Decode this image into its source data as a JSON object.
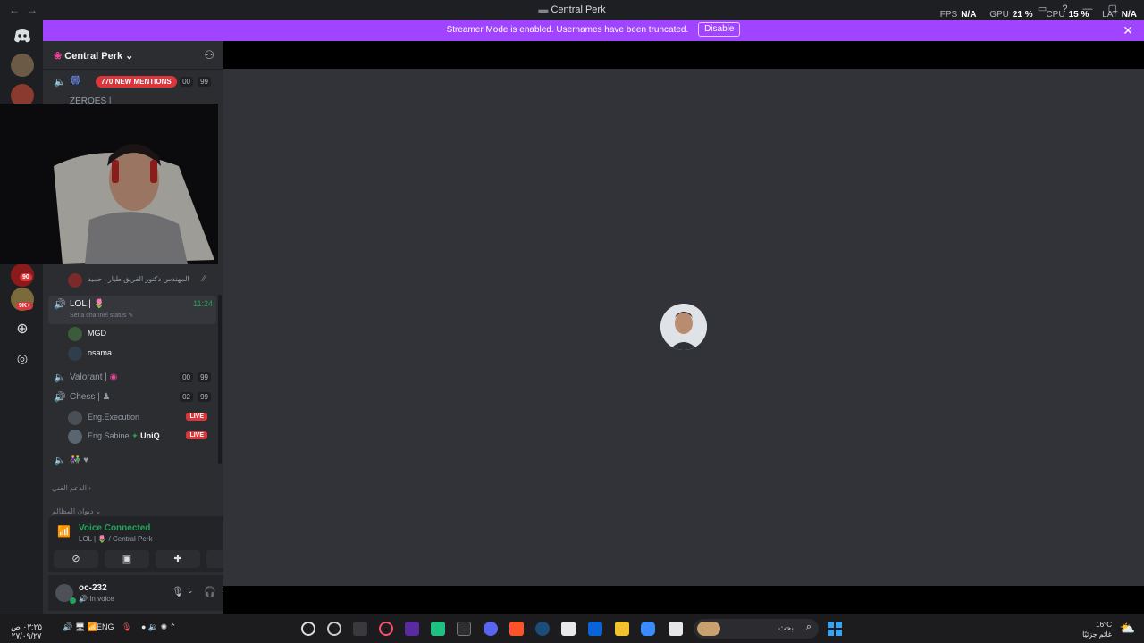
{
  "titlebar": {
    "back": "←",
    "forward": "→",
    "title": "Central Perk",
    "stats": {
      "fps_label": "FPS",
      "fps_value": "N/A",
      "gpu_label": "GPU",
      "gpu_value": "21 %",
      "cpu_label": "CPU",
      "cpu_value": "15 %",
      "lat_label": "LAT",
      "lat_value": "N/A"
    }
  },
  "banner": {
    "text": "Streamer Mode is enabled. Usernames have been truncated.",
    "button": "Disable",
    "close": "✕"
  },
  "server": {
    "name": "Central Perk"
  },
  "channels": {
    "top_row": {
      "mentions": "770 NEW MENTIONS",
      "left": "00",
      "right": "99"
    },
    "hidden_row_text": "ZEROES | ",
    "arabic_user": "المهندس دكتور الفريق طيار . حميد",
    "lol": {
      "name": "LOL | ",
      "time": "11:24",
      "status_placeholder": "Set a channel status"
    },
    "lol_users": [
      "MGD",
      "osama"
    ],
    "valorant": {
      "name": "Valorant | ",
      "left": "00",
      "right": "99"
    },
    "chess": {
      "name": "Chess | ",
      "left": "02",
      "right": "99"
    },
    "chess_users": [
      {
        "name": "Eng.Execution",
        "badge": "LIVE"
      },
      {
        "name": "Eng.Sabine",
        "tag": "UniQ",
        "badge": "LIVE"
      }
    ],
    "category1": "الدعم الفني",
    "category2": "ديوان المظالم"
  },
  "guild_badges": {
    "b1": "90",
    "b2": "9K+"
  },
  "voice": {
    "title": "Voice Connected",
    "subtitle": "LOL | 🌷 / Central Perk"
  },
  "user_panel": {
    "name": "oc-232",
    "status": "In voice"
  },
  "taskbar": {
    "time": "٠٣:٢٥ ص",
    "date": "٢٧/٠٩/٢٧",
    "lang": "ENG",
    "search_placeholder": "بحث",
    "weather_temp": "16°C",
    "weather_desc": "غائم جزئيًا"
  },
  "colors": {
    "accent": "#a044ff",
    "green": "#23a559",
    "red": "#da373c",
    "bg": "#313338"
  }
}
